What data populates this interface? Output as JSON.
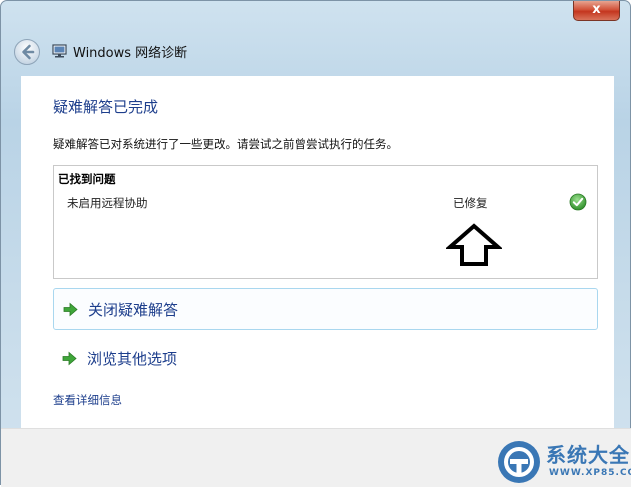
{
  "window": {
    "title": "Windows 网络诊断",
    "close_label": "x"
  },
  "main": {
    "heading": "疑难解答已完成",
    "description": "疑难解答已对系统进行了一些更改。请尝试之前曾尝试执行的任务。",
    "found": {
      "header": "已找到问题",
      "issues": [
        {
          "name": "未启用远程协助",
          "status": "已修复"
        }
      ]
    },
    "actions": [
      {
        "label": "关闭疑难解答"
      },
      {
        "label": "浏览其他选项"
      }
    ],
    "details_link": "查看详细信息"
  },
  "watermark": {
    "title": "系统大全",
    "url": "WWW.XP85.COM"
  },
  "colors": {
    "accent_text": "#1d3e8c",
    "success": "#3fa63a",
    "close": "#c4361f",
    "frame": "#b9d3e6"
  },
  "icons": [
    "back-arrow-icon",
    "network-diagnostics-icon",
    "check-icon",
    "up-arrow-icon",
    "green-arrow-icon"
  ]
}
